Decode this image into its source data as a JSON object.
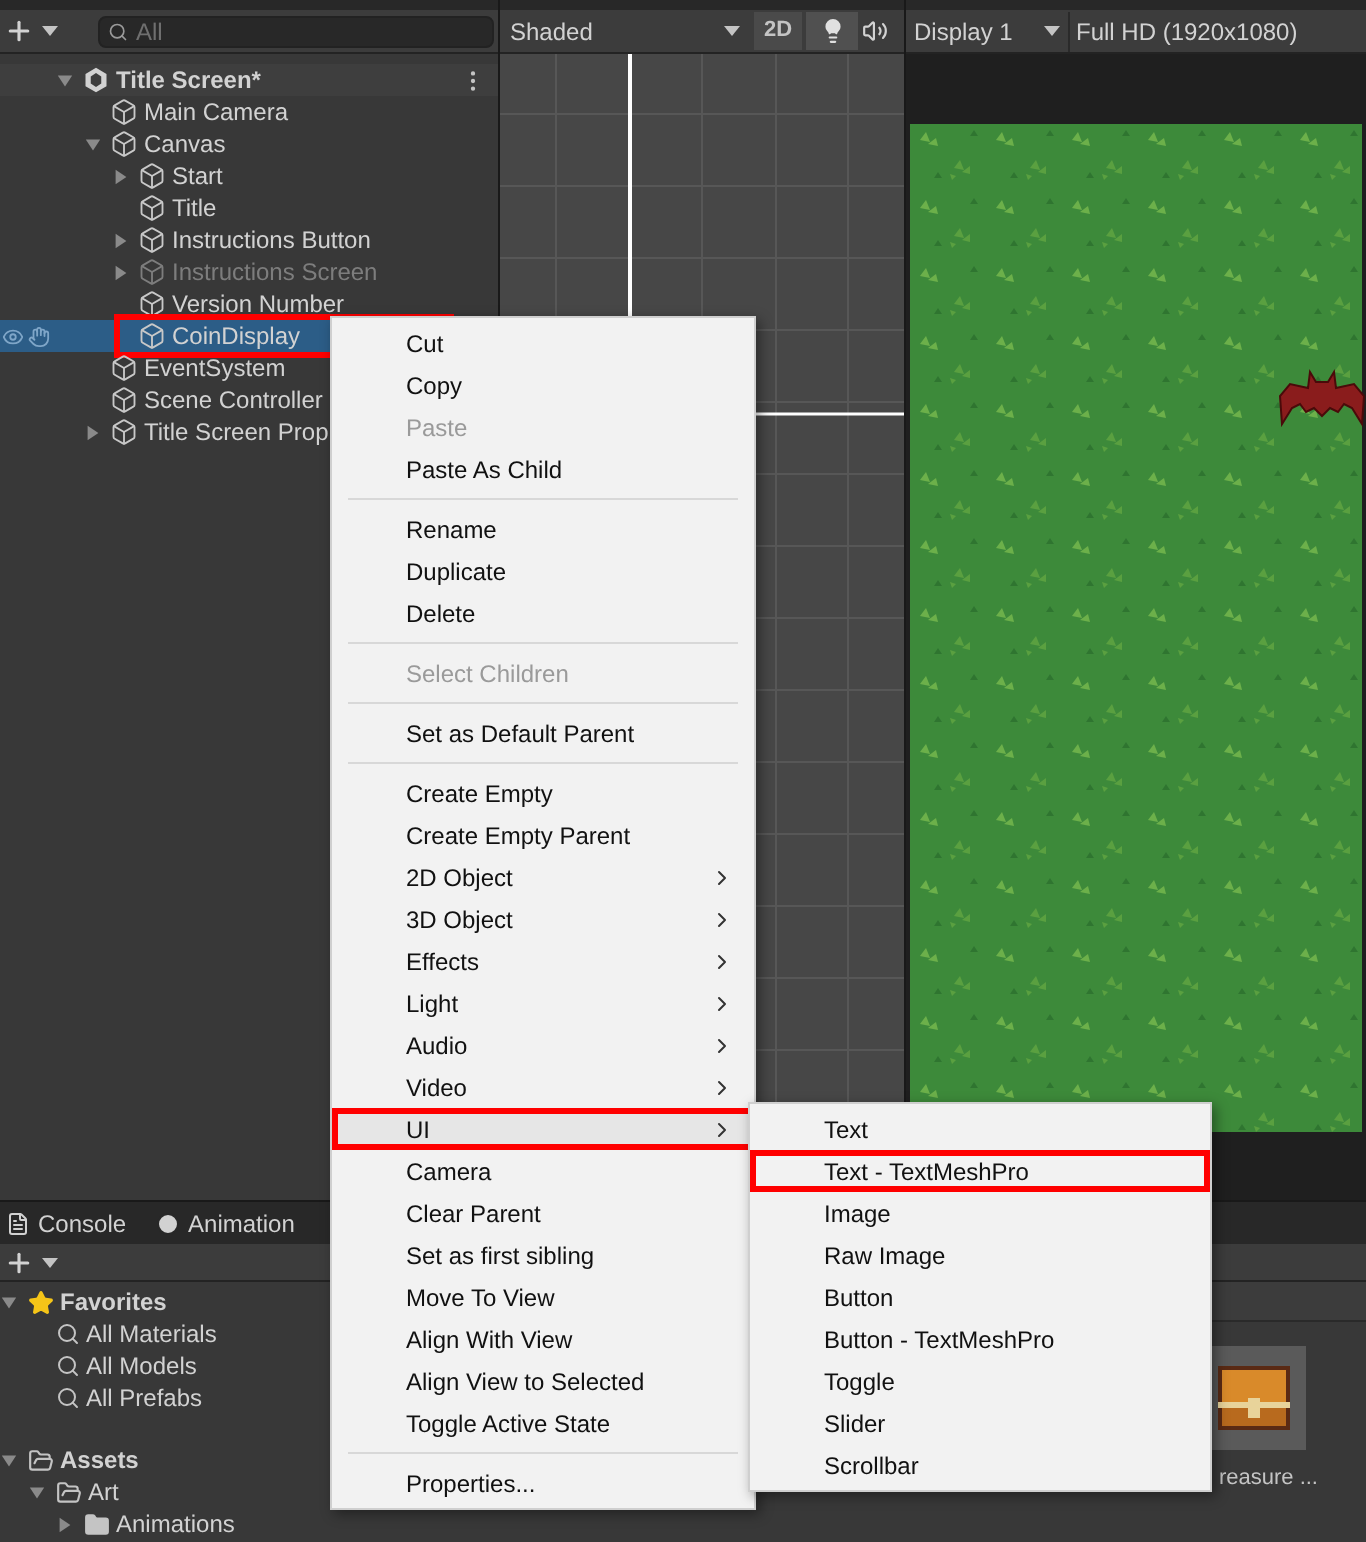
{
  "hierarchy": {
    "search": {
      "placeholder": "All"
    },
    "tree": [
      {
        "label": "Title Screen*",
        "kind": "scene",
        "expanded": true,
        "selected": false,
        "disabled": false,
        "annotated": false,
        "children": [
          {
            "label": "Main Camera",
            "kind": "object",
            "selected": false,
            "disabled": false,
            "annotated": false
          },
          {
            "label": "Canvas",
            "kind": "object",
            "expanded": true,
            "selected": false,
            "disabled": false,
            "annotated": false,
            "children": [
              {
                "label": "Start",
                "kind": "object",
                "expanded": false,
                "selected": false,
                "disabled": false,
                "annotated": false
              },
              {
                "label": "Title",
                "kind": "object",
                "selected": false,
                "disabled": false,
                "annotated": false
              },
              {
                "label": "Instructions Button",
                "kind": "object",
                "expanded": false,
                "selected": false,
                "disabled": false,
                "annotated": false
              },
              {
                "label": "Instructions Screen",
                "kind": "object",
                "expanded": false,
                "selected": false,
                "disabled": true,
                "annotated": false
              },
              {
                "label": "Version Number",
                "kind": "object",
                "selected": false,
                "disabled": false,
                "annotated": false
              },
              {
                "label": "CoinDisplay",
                "kind": "object",
                "selected": true,
                "disabled": false,
                "annotated": true
              }
            ]
          },
          {
            "label": "EventSystem",
            "kind": "object",
            "selected": false,
            "disabled": false,
            "annotated": false
          },
          {
            "label": "Scene Controller",
            "kind": "object",
            "selected": false,
            "disabled": false,
            "annotated": false
          },
          {
            "label": "Title Screen Prop",
            "kind": "object",
            "expanded": false,
            "selected": false,
            "disabled": false,
            "annotated": false
          }
        ]
      }
    ]
  },
  "scene_view": {
    "shading": "Shaded",
    "mode_button": "2D"
  },
  "game_view": {
    "display": "Display 1",
    "resolution": "Full HD (1920x1080)"
  },
  "bottom_tabs": [
    {
      "label": "Console",
      "kind": "console",
      "selected": false
    },
    {
      "label": "Animation",
      "kind": "animation",
      "selected": false
    }
  ],
  "project_tree": [
    {
      "label": "Favorites",
      "kind": "favorites",
      "expanded": true,
      "children": [
        {
          "label": "All Materials",
          "kind": "search"
        },
        {
          "label": "All Models",
          "kind": "search"
        },
        {
          "label": "All Prefabs",
          "kind": "search"
        }
      ]
    },
    {
      "label": "Assets",
      "kind": "folder",
      "expanded": true,
      "children": [
        {
          "label": "Art",
          "kind": "folder",
          "expanded": true,
          "children": [
            {
              "label": "Animations",
              "kind": "folder",
              "expanded": false
            }
          ]
        }
      ]
    }
  ],
  "asset_thumbnail": {
    "label": "reasure ..."
  },
  "context_menu": {
    "items": [
      {
        "kind": "item",
        "label": "Cut",
        "disabled": false,
        "has_submenu": false,
        "selected": false,
        "annotated": false
      },
      {
        "kind": "item",
        "label": "Copy",
        "disabled": false,
        "has_submenu": false,
        "selected": false,
        "annotated": false
      },
      {
        "kind": "item",
        "label": "Paste",
        "disabled": true,
        "has_submenu": false,
        "selected": false,
        "annotated": false
      },
      {
        "kind": "item",
        "label": "Paste As Child",
        "disabled": false,
        "has_submenu": false,
        "selected": false,
        "annotated": false
      },
      {
        "kind": "separator"
      },
      {
        "kind": "item",
        "label": "Rename",
        "disabled": false,
        "has_submenu": false,
        "selected": false,
        "annotated": false
      },
      {
        "kind": "item",
        "label": "Duplicate",
        "disabled": false,
        "has_submenu": false,
        "selected": false,
        "annotated": false
      },
      {
        "kind": "item",
        "label": "Delete",
        "disabled": false,
        "has_submenu": false,
        "selected": false,
        "annotated": false
      },
      {
        "kind": "separator"
      },
      {
        "kind": "item",
        "label": "Select Children",
        "disabled": true,
        "has_submenu": false,
        "selected": false,
        "annotated": false
      },
      {
        "kind": "separator"
      },
      {
        "kind": "item",
        "label": "Set as Default Parent",
        "disabled": false,
        "has_submenu": false,
        "selected": false,
        "annotated": false
      },
      {
        "kind": "separator"
      },
      {
        "kind": "item",
        "label": "Create Empty",
        "disabled": false,
        "has_submenu": false,
        "selected": false,
        "annotated": false
      },
      {
        "kind": "item",
        "label": "Create Empty Parent",
        "disabled": false,
        "has_submenu": false,
        "selected": false,
        "annotated": false
      },
      {
        "kind": "item",
        "label": "2D Object",
        "disabled": false,
        "has_submenu": true,
        "selected": false,
        "annotated": false
      },
      {
        "kind": "item",
        "label": "3D Object",
        "disabled": false,
        "has_submenu": true,
        "selected": false,
        "annotated": false
      },
      {
        "kind": "item",
        "label": "Effects",
        "disabled": false,
        "has_submenu": true,
        "selected": false,
        "annotated": false
      },
      {
        "kind": "item",
        "label": "Light",
        "disabled": false,
        "has_submenu": true,
        "selected": false,
        "annotated": false
      },
      {
        "kind": "item",
        "label": "Audio",
        "disabled": false,
        "has_submenu": true,
        "selected": false,
        "annotated": false
      },
      {
        "kind": "item",
        "label": "Video",
        "disabled": false,
        "has_submenu": true,
        "selected": false,
        "annotated": false
      },
      {
        "kind": "item",
        "label": "UI",
        "disabled": false,
        "has_submenu": true,
        "selected": true,
        "annotated": true
      },
      {
        "kind": "item",
        "label": "Camera",
        "disabled": false,
        "has_submenu": false,
        "selected": false,
        "annotated": false
      },
      {
        "kind": "item",
        "label": "Clear Parent",
        "disabled": false,
        "has_submenu": false,
        "selected": false,
        "annotated": false
      },
      {
        "kind": "item",
        "label": "Set as first sibling",
        "disabled": false,
        "has_submenu": false,
        "selected": false,
        "annotated": false
      },
      {
        "kind": "item",
        "label": "Move To View",
        "disabled": false,
        "has_submenu": false,
        "selected": false,
        "annotated": false
      },
      {
        "kind": "item",
        "label": "Align With View",
        "disabled": false,
        "has_submenu": false,
        "selected": false,
        "annotated": false
      },
      {
        "kind": "item",
        "label": "Align View to Selected",
        "disabled": false,
        "has_submenu": false,
        "selected": false,
        "annotated": false
      },
      {
        "kind": "item",
        "label": "Toggle Active State",
        "disabled": false,
        "has_submenu": false,
        "selected": false,
        "annotated": false
      },
      {
        "kind": "separator"
      },
      {
        "kind": "item",
        "label": "Properties...",
        "disabled": false,
        "has_submenu": false,
        "selected": false,
        "annotated": false
      }
    ]
  },
  "submenu": {
    "items": [
      {
        "kind": "item",
        "label": "Text",
        "disabled": false,
        "has_submenu": false,
        "selected": false,
        "annotated": false
      },
      {
        "kind": "item",
        "label": "Text - TextMeshPro",
        "disabled": false,
        "has_submenu": false,
        "selected": false,
        "annotated": true
      },
      {
        "kind": "item",
        "label": "Image",
        "disabled": false,
        "has_submenu": false,
        "selected": false,
        "annotated": false
      },
      {
        "kind": "item",
        "label": "Raw Image",
        "disabled": false,
        "has_submenu": false,
        "selected": false,
        "annotated": false
      },
      {
        "kind": "item",
        "label": "Button",
        "disabled": false,
        "has_submenu": false,
        "selected": false,
        "annotated": false
      },
      {
        "kind": "item",
        "label": "Button - TextMeshPro",
        "disabled": false,
        "has_submenu": false,
        "selected": false,
        "annotated": false
      },
      {
        "kind": "item",
        "label": "Toggle",
        "disabled": false,
        "has_submenu": false,
        "selected": false,
        "annotated": false
      },
      {
        "kind": "item",
        "label": "Slider",
        "disabled": false,
        "has_submenu": false,
        "selected": false,
        "annotated": false
      },
      {
        "kind": "item",
        "label": "Scrollbar",
        "disabled": false,
        "has_submenu": false,
        "selected": false,
        "annotated": false
      }
    ]
  }
}
